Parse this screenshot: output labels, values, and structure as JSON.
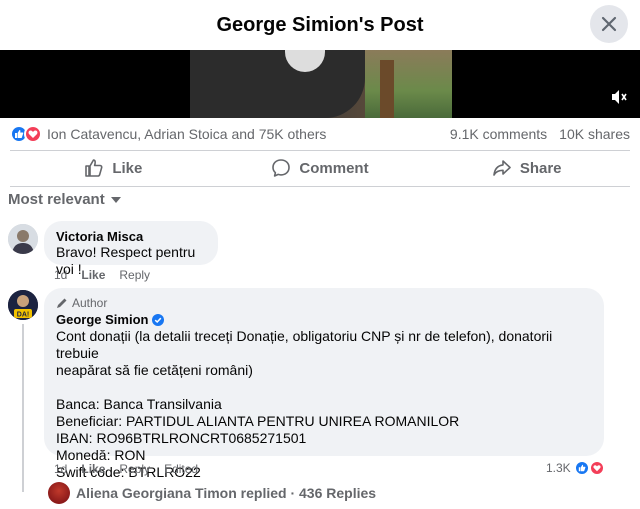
{
  "header": {
    "title": "George Simion's Post"
  },
  "stats": {
    "reactors": "Ion Catavencu, Adrian Stoica and 75K others",
    "comments": "9.1K comments",
    "shares": "10K shares"
  },
  "actions": {
    "like": "Like",
    "comment": "Comment",
    "share": "Share"
  },
  "sort_label": "Most relevant",
  "comments": [
    {
      "name": "Victoria Misca",
      "text": "Bravo! Respect pentru voi !",
      "time": "1d",
      "like": "Like",
      "reply": "Reply"
    },
    {
      "author_tag": "Author",
      "name": "George Simion",
      "lines": [
        "Cont donații (la detalii treceți Donație, obligatoriu CNP și nr de telefon), donatorii trebuie",
        "neapărat să fie cetățeni români)",
        "",
        "Banca: Banca Transilvania",
        "Beneficiar: PARTIDUL ALIANTA PENTRU UNIREA ROMANILOR",
        "IBAN: RO96BTRLRONCRT0685271501",
        "Monedă: RON",
        "Swift code: BTRLRO22"
      ],
      "time": "1d",
      "like": "Like",
      "reply": "Reply",
      "edited": "Edited",
      "reaction_count": "1.3K"
    }
  ],
  "replies_text": "Aliena Georgiana Timon replied · 436 Replies",
  "colors": {
    "like_blue": "#1877f2",
    "love_red": "#f33e58",
    "muted": "#65676b"
  }
}
